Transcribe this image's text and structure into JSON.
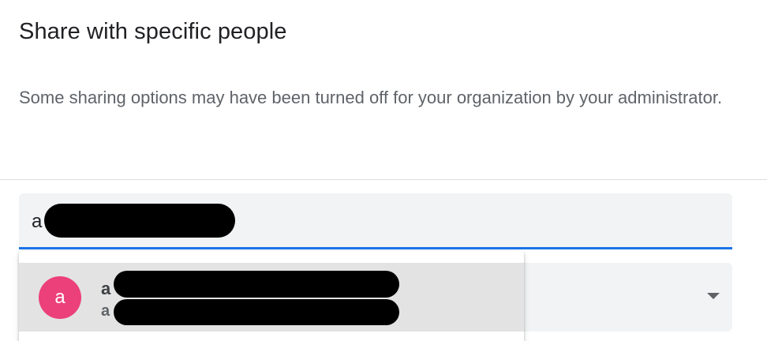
{
  "dialog": {
    "title": "Share with specific people",
    "description": "Some sharing options may have been turned off for your organization by your administrator."
  },
  "search": {
    "value": "a"
  },
  "suggestions": [
    {
      "avatar_letter": "a",
      "name_visible": "a",
      "email_visible": "a",
      "avatar_color": "#ec407a"
    }
  ],
  "colors": {
    "focus_underline": "#1a73e8",
    "field_background": "#f1f3f4",
    "highlight_row": "#e3e3e3"
  },
  "icons": {
    "permission_dropdown": "caret-down-icon"
  }
}
